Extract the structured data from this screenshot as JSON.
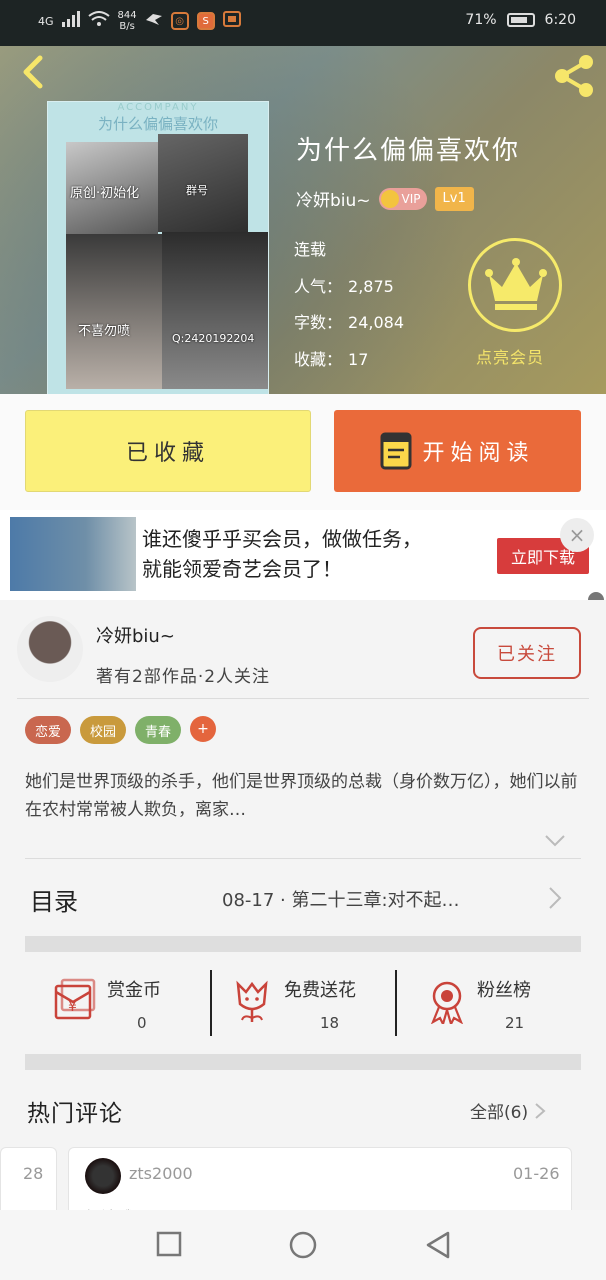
{
  "status_bar": {
    "network": "4G",
    "speed_value": "844",
    "speed_unit": "B/s",
    "battery": "71%",
    "time": "6:20"
  },
  "book": {
    "title": "为什么偏偏喜欢你",
    "author": "冷妍biu~",
    "vip_label": "VIP",
    "level": "Lv1",
    "status": "连载",
    "popularity_label": "人气：",
    "popularity": "2,875",
    "words_label": "字数：",
    "words": "24,084",
    "favorites_label": "收藏：",
    "favorites": "17",
    "cover": {
      "header_en": "ACCOMPANY",
      "header_cn": "为什么偏偏喜欢你",
      "tag1": "原创·初始化",
      "tag2": "不喜勿喷",
      "tag3": "群号",
      "tag4": "Q:2420192204"
    }
  },
  "vip_promo": {
    "label": "点亮会员"
  },
  "actions": {
    "collected_label": "已收藏",
    "read_label": "开始阅读"
  },
  "ad": {
    "line1": "谁还傻乎乎买会员，做做任务，",
    "line2": "就能领爱奇艺会员了！",
    "cta": "立即下载",
    "close": "×"
  },
  "author_section": {
    "name": "冷妍biu~",
    "meta": "著有2部作品·2人关注",
    "follow_label": "已关注",
    "tags": [
      {
        "label": "恋爱",
        "color": "#c9674f"
      },
      {
        "label": "校园",
        "color": "#c99a3c"
      },
      {
        "label": "青春",
        "color": "#7fb069"
      }
    ],
    "tag_more": "+",
    "synopsis": "她们是世界顶级的杀手，他们是世界顶级的总裁（身价数万亿），她们以前在农村常常被人欺负，离家…"
  },
  "toc": {
    "label": "目录",
    "latest": "08-17 · 第二十三章:对不起…"
  },
  "rewards": [
    {
      "label": "赏金币",
      "value": "0",
      "icon": "red-envelope-icon"
    },
    {
      "label": "免费送花",
      "value": "18",
      "icon": "flower-icon"
    },
    {
      "label": "粉丝榜",
      "value": "21",
      "icon": "medal-icon"
    }
  ],
  "comments": {
    "title": "热门评论",
    "all_label": "全部(6)",
    "prev_date": "28",
    "item": {
      "user": "zts2000",
      "date": "01-26",
      "body": "加油哦"
    }
  },
  "colors": {
    "accent_orange": "#ea6a3a",
    "collected_yellow": "#fbf07a",
    "follow_red": "#c84a3c",
    "vip_gold": "#f6ea6a"
  }
}
